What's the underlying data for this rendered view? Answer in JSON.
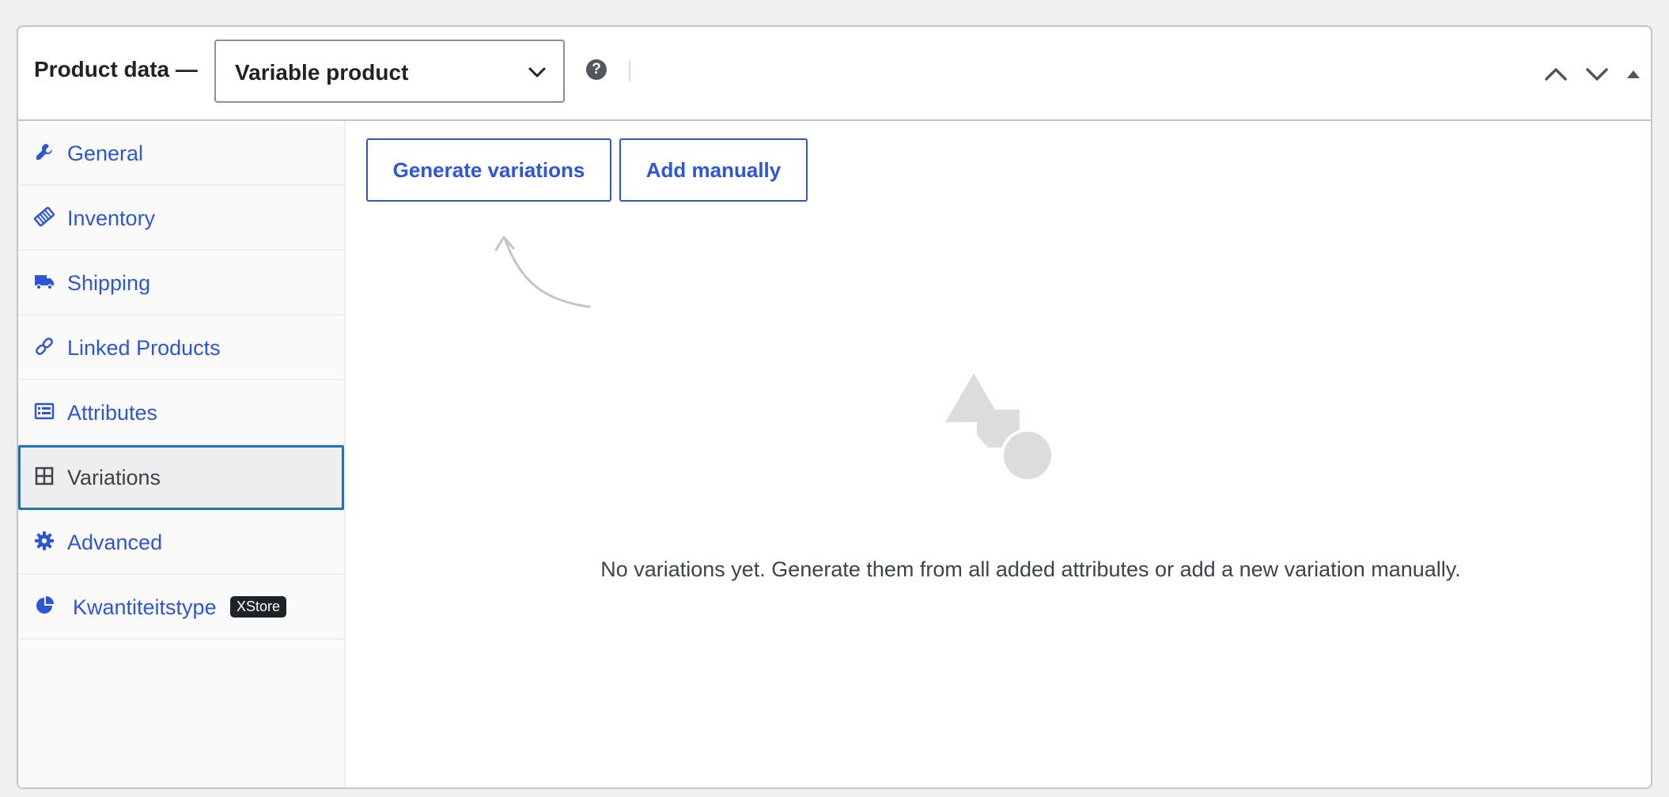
{
  "header": {
    "title": "Product data —",
    "product_type": "Variable product",
    "help_icon": "question-circle-icon",
    "controls": [
      "move-up-icon",
      "move-down-icon",
      "toggle-panel-icon"
    ]
  },
  "sidebar": {
    "tabs": [
      {
        "label": "General",
        "icon": "wrench-icon"
      },
      {
        "label": "Inventory",
        "icon": "tag-icon"
      },
      {
        "label": "Shipping",
        "icon": "truck-icon"
      },
      {
        "label": "Linked Products",
        "icon": "link-icon"
      },
      {
        "label": "Attributes",
        "icon": "list-card-icon"
      },
      {
        "label": "Variations",
        "icon": "grid-icon",
        "active": true
      },
      {
        "label": "Advanced",
        "icon": "gear-icon"
      },
      {
        "label": "Kwantiteitstype",
        "icon": "pie-chart-icon",
        "badge": "XStore"
      }
    ]
  },
  "main": {
    "generate_button": "Generate variations",
    "add_manually_button": "Add manually",
    "empty_message": "No variations yet. Generate them from all added attributes or add a new variation manually."
  },
  "colors": {
    "accent": "#2c56d6",
    "active_border": "#2271b1",
    "muted": "#dcdcde"
  }
}
